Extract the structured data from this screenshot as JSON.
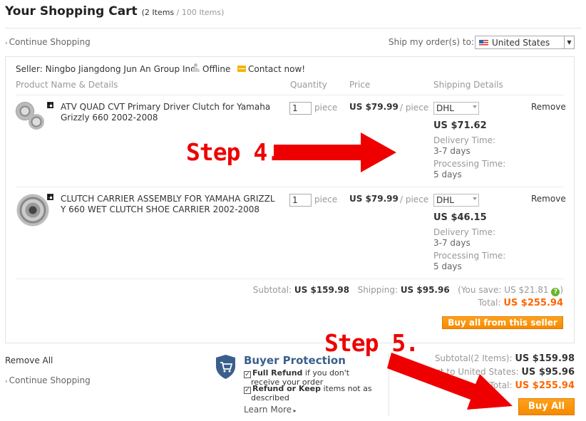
{
  "header": {
    "title": "Your Shopping Cart",
    "count_text": "(2 Items",
    "total_text": " / 100 Items)"
  },
  "nav": {
    "continue_shopping": "Continue Shopping",
    "chevron": "‹"
  },
  "ship_to": {
    "label": "Ship my order(s) to:",
    "country": "United States",
    "flag_icon": "us-flag-icon"
  },
  "seller": {
    "label": "Seller:",
    "name": "Ningbo Jiangdong Jun An Group Inc.",
    "status": "Offline",
    "contact": "Contact now!"
  },
  "columns": {
    "product": "Product Name & Details",
    "quantity": "Quantity",
    "price": "Price",
    "shipping": "Shipping Details"
  },
  "items": [
    {
      "name_line1": "ATV QUAD CVT Primary Driver Clutch for Yamaha",
      "name_line2": "Grizzly 660 2002-2008",
      "qty": "1",
      "qty_unit": "piece",
      "price": "US $79.99",
      "price_unit": "/ piece",
      "shipping_method": "DHL",
      "shipping_cost": "US $71.62",
      "delivery_label": "Delivery Time:",
      "delivery_value": "3-7 days",
      "processing_label": "Processing Time:",
      "processing_value": "5 days",
      "remove": "Remove"
    },
    {
      "name_line1": "CLUTCH CARRIER ASSEMBLY FOR YAMAHA GRIZZL",
      "name_line2": "Y 660 WET CLUTCH SHOE CARRIER 2002-2008",
      "qty": "1",
      "qty_unit": "piece",
      "price": "US $79.99",
      "price_unit": "/ piece",
      "shipping_method": "DHL",
      "shipping_cost": "US $46.15",
      "delivery_label": "Delivery Time:",
      "delivery_value": "3-7 days",
      "processing_label": "Processing Time:",
      "processing_value": "5 days",
      "remove": "Remove"
    }
  ],
  "seller_totals": {
    "subtotal_label": "Subtotal:",
    "subtotal_value": "US $159.98",
    "shipping_label": "Shipping:",
    "shipping_value": "US $95.96",
    "save_text": "(You save: US $21.81",
    "save_close": ")",
    "total_label": "Total:",
    "total_value": "US $255.94",
    "buy_seller_button": "Buy all from this seller"
  },
  "footer": {
    "remove_all": "Remove All",
    "continue_shopping": "Continue Shopping"
  },
  "buyer_protection": {
    "title": "Buyer Protection",
    "line1_bold": "Full Refund",
    "line1_rest": " if you don't",
    "line1_cont": "receive your order",
    "line2_bold": "Refund or Keep",
    "line2_rest": " items not as",
    "line2_cont": "described",
    "learn_more": "Learn More"
  },
  "order_totals": {
    "subtotal_label": "Subtotal(2 Items):",
    "subtotal_value": "US $159.98",
    "cost_label": "Cost to United States:",
    "cost_value": "US $95.96",
    "all_total_label": "All Total:",
    "all_total_value": "US $255.94",
    "buy_all_button": "Buy All"
  },
  "annotations": {
    "step4": "Step 4.",
    "step5": "Step 5.",
    "arrow_color": "#ee0000"
  },
  "colors": {
    "accent_orange": "#f60",
    "button_orange": "#f58a00",
    "brand_blue": "#3a5f8c"
  }
}
